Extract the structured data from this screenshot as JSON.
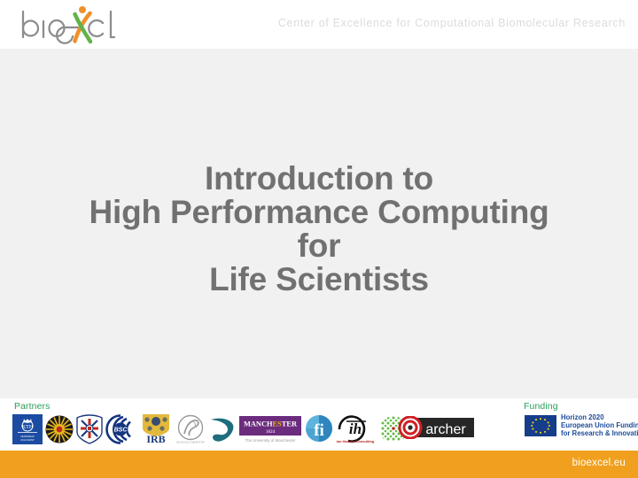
{
  "slide": {
    "background_color": "#f1f1f1",
    "header_background": "#ffffff",
    "accent_orange": "#f0a01e",
    "accent_green": "#2aa05a",
    "title_color": "#717171"
  },
  "header": {
    "logo_name": "bioexcel-logo",
    "logo_text_left": "bio",
    "logo_text_right": "cel",
    "tagline": "Center of Excellence for Computational Biomolecular Research"
  },
  "title": {
    "lines": [
      "Introduction to",
      "High Performance Computing",
      "for",
      "Life Scientists"
    ]
  },
  "footer": {
    "partners_label": "Partners",
    "funding_label": "Funding",
    "partner_logos": [
      {
        "name": "kth-logo",
        "caption": "KTH"
      },
      {
        "name": "university-of-jyvaskyla-logo",
        "caption": ""
      },
      {
        "name": "university-of-edinburgh-logo",
        "caption": ""
      },
      {
        "name": "bsc-logo",
        "caption": "BSC"
      },
      {
        "name": "irb-logo",
        "caption": "IRB"
      },
      {
        "name": "nostrum-biodiscovery-logo",
        "caption": ""
      },
      {
        "name": "forschungszentrum-juelich-logo",
        "caption": ""
      },
      {
        "name": "university-of-manchester-logo",
        "caption": "MANCHESTER",
        "caption2": "1824",
        "caption3": "The University of Manchester"
      },
      {
        "name": "fi-institute-logo",
        "caption": "fi"
      },
      {
        "name": "ian-harrow-consulting-logo",
        "caption": "Cih",
        "caption2": "Ian Harrow Consulting"
      },
      {
        "name": "pharmacelera-logo",
        "caption": ""
      }
    ],
    "archer_logo": {
      "name": "archer-logo",
      "label": "archer"
    },
    "eu_funding": {
      "flag_name": "eu-flag-icon",
      "lines": [
        "Horizon 2020",
        "European Union Funding",
        "for Research & Innovation"
      ],
      "text_color": "#1c4b9c"
    },
    "url": "bioexcel.eu"
  }
}
